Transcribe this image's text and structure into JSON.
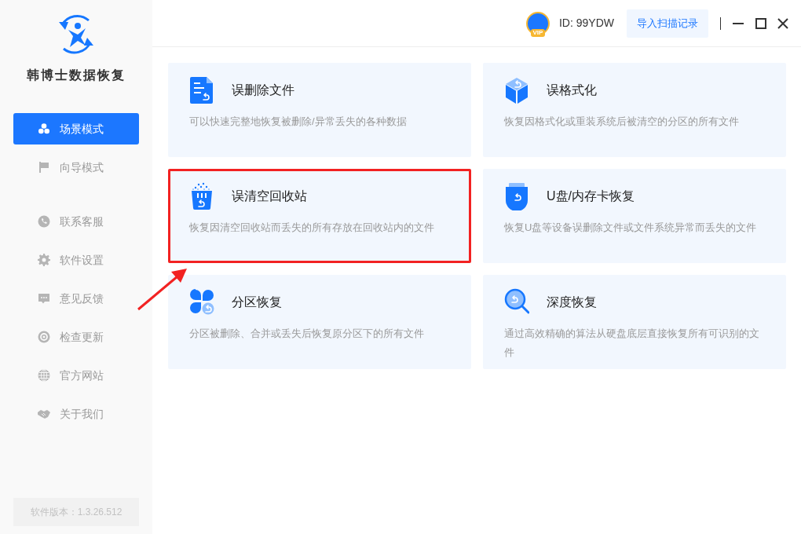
{
  "app": {
    "name": "韩博士数据恢复"
  },
  "sidebar": {
    "items": [
      {
        "kind": "scene",
        "label": "场景模式",
        "selected": true
      },
      {
        "kind": "flag",
        "label": "向导模式",
        "selected": false
      },
      {
        "kind": "phone",
        "label": "联系客服",
        "selected": false
      },
      {
        "kind": "gear",
        "label": "软件设置",
        "selected": false
      },
      {
        "kind": "chat",
        "label": "意见反馈",
        "selected": false
      },
      {
        "kind": "refresh",
        "label": "检查更新",
        "selected": false
      },
      {
        "kind": "globe",
        "label": "官方网站",
        "selected": false
      },
      {
        "kind": "handshake",
        "label": "关于我们",
        "selected": false
      }
    ],
    "version": "软件版本：1.3.26.512"
  },
  "header": {
    "user_id": "ID: 99YDW",
    "import_button": "导入扫描记录",
    "vip_badge": "VIP"
  },
  "cards": [
    {
      "kind": "file",
      "title": "误删除文件",
      "description": "可以快速完整地恢复被删除/异常丢失的各种数据",
      "highlighted": false
    },
    {
      "kind": "format",
      "title": "误格式化",
      "description": "恢复因格式化或重装系统后被清空的分区的所有文件",
      "highlighted": false
    },
    {
      "kind": "recycle",
      "title": "误清空回收站",
      "description": "恢复因清空回收站而丢失的所有存放在回收站内的文件",
      "highlighted": true
    },
    {
      "kind": "usb",
      "title": "U盘/内存卡恢复",
      "description": "恢复U盘等设备误删除文件或文件系统异常而丢失的文件",
      "highlighted": false
    },
    {
      "kind": "partition",
      "title": "分区恢复",
      "description": "分区被删除、合并或丢失后恢复原分区下的所有文件",
      "highlighted": false
    },
    {
      "kind": "deep",
      "title": "深度恢复",
      "description": "通过高效精确的算法从硬盘底层直接恢复所有可识别的文件",
      "highlighted": false
    }
  ]
}
